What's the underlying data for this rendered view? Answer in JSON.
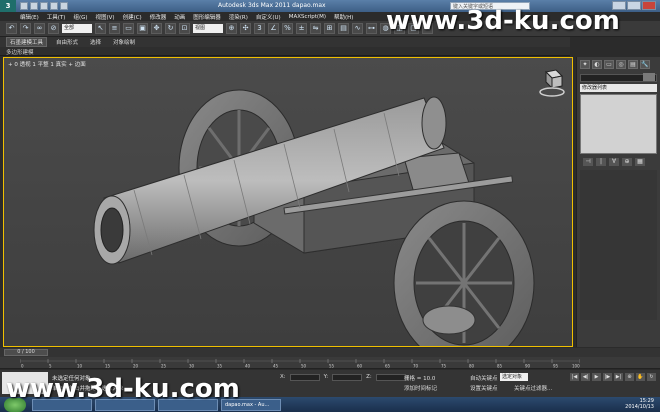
{
  "window": {
    "title": "Autodesk 3ds Max  2011      dapao.max",
    "help_search_placeholder": "键入关键字或短语"
  },
  "menu": [
    "编辑(E)",
    "工具(T)",
    "组(G)",
    "视图(V)",
    "创建(C)",
    "修改器",
    "动画",
    "图形编辑器",
    "渲染(R)",
    "自定义(U)",
    "MAXScript(M)",
    "帮助(H)"
  ],
  "toolbar": {
    "selection_filter": "全部",
    "view_select": "视图"
  },
  "ribbon": {
    "tabs": [
      "石墨建模工具",
      "自由形式",
      "选择",
      "对象绘制"
    ],
    "sub_label": "多边形建模"
  },
  "viewport": {
    "label": "+ 0 透视 1 平整 1 真实 + 边面"
  },
  "command_panel": {
    "tabs": [
      "✦",
      "◐",
      "▭",
      "◎",
      "▤",
      "🔧"
    ],
    "modifier_list": "修改器列表",
    "stack_icons": [
      "⊣",
      "|",
      "∀",
      "⊕",
      "▦"
    ]
  },
  "timeline": {
    "slider": "0 / 100",
    "ticks": [
      "0",
      "5",
      "10",
      "15",
      "20",
      "25",
      "30",
      "35",
      "40",
      "45",
      "50",
      "55",
      "60",
      "65",
      "70",
      "75",
      "80",
      "85",
      "90",
      "95",
      "100"
    ]
  },
  "status": {
    "selection": "未选定任何对象",
    "hint": "单击或单击并拖动以选择对象",
    "x_label": "X:",
    "y_label": "Y:",
    "z_label": "Z:",
    "grid": "栅格 = 10.0",
    "add_time_tag": "添加时间标记",
    "auto_key": "自动关键点",
    "selection_set": "选定对象",
    "set_key": "设置关键点",
    "key_filters": "关键点过滤器..."
  },
  "taskbar": {
    "items": [
      "",
      "",
      "",
      "dapao.max - Au..."
    ],
    "time": "15:29",
    "date": "2014/10/13"
  },
  "watermark": "www.3d-ku.com"
}
